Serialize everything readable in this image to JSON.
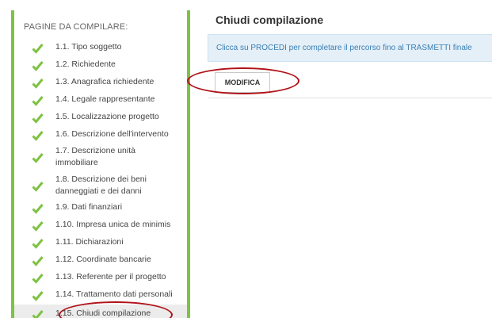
{
  "sidebar": {
    "header": "PAGINE DA COMPILARE:",
    "items": [
      {
        "label": "1.1. Tipo soggetto"
      },
      {
        "label": "1.2. Richiedente"
      },
      {
        "label": "1.3. Anagrafica richiedente"
      },
      {
        "label": "1.4. Legale rappresentante"
      },
      {
        "label": "1.5. Localizzazione progetto"
      },
      {
        "label": "1.6. Descrizione dell'intervento"
      },
      {
        "label": "1.7. Descrizione unità immobiliare"
      },
      {
        "label": "1.8. Descrizione dei beni danneggiati e dei danni"
      },
      {
        "label": "1.9. Dati finanziari"
      },
      {
        "label": "1.10. Impresa unica de minimis"
      },
      {
        "label": "1.11. Dichiarazioni"
      },
      {
        "label": "1.12. Coordinate bancarie"
      },
      {
        "label": "1.13. Referente per il progetto"
      },
      {
        "label": "1.14. Trattamento dati personali"
      },
      {
        "label": "1.15. Chiudi compilazione"
      }
    ]
  },
  "main": {
    "title": "Chiudi compilazione",
    "info": "Clicca su PROCEDI per completare il percorso fino al TRASMETTI finale",
    "modifica_label": "MODIFICA"
  },
  "colors": {
    "accent_green": "#7ec242",
    "info_text": "#3a7fb4",
    "annotation_red": "#b01218"
  },
  "icons": {
    "step_status": "check-icon"
  }
}
